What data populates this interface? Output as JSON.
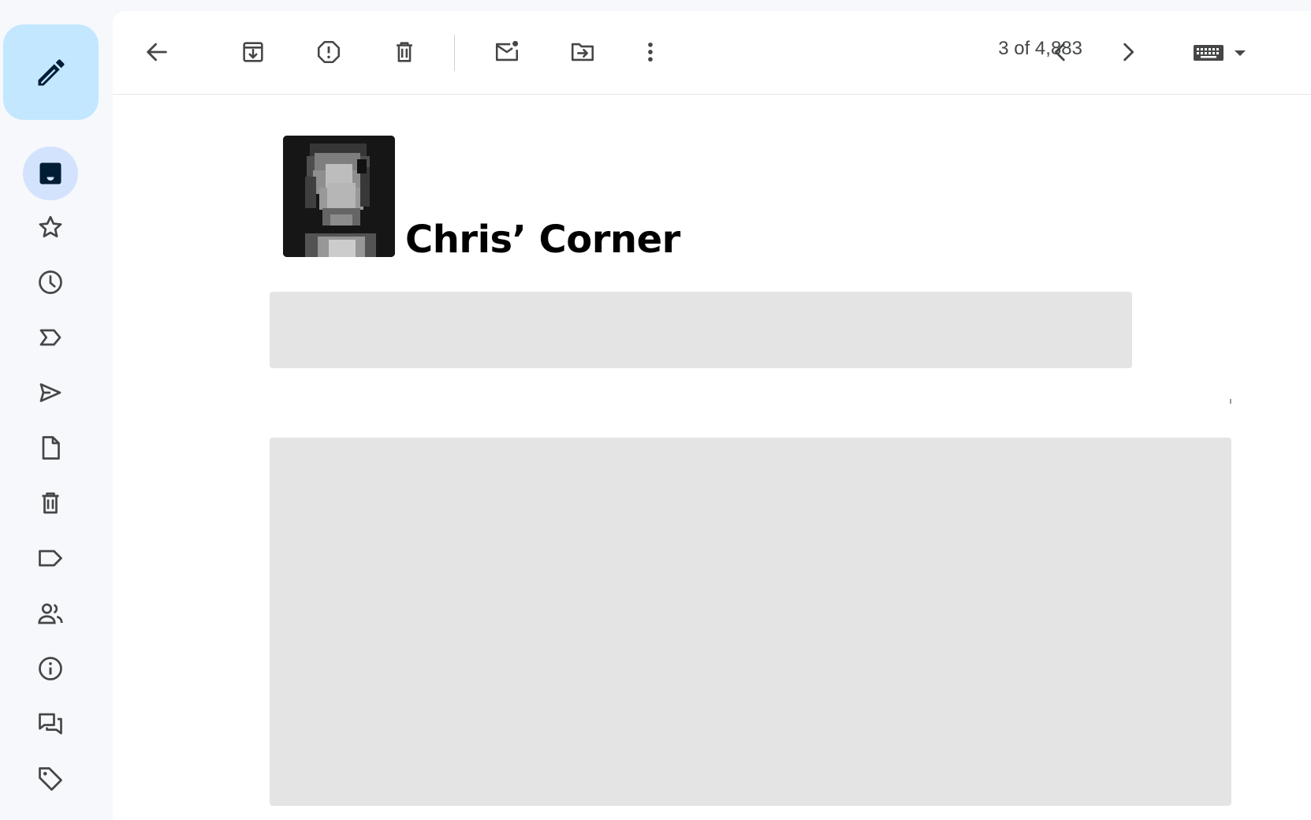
{
  "toolbar": {
    "pager_text": "3 of 4,883"
  },
  "email": {
    "sender_name": "Chris’ Corner"
  },
  "colors": {
    "rail_background": "#f6f8fc",
    "compose_background": "#c2e7ff",
    "active_item_background": "#d3e3fd",
    "placeholder": "#e4e4e4"
  },
  "rail": {
    "items": [
      {
        "name": "inbox",
        "icon": "inbox-icon",
        "active": true
      },
      {
        "name": "starred",
        "icon": "star-icon"
      },
      {
        "name": "snoozed",
        "icon": "clock-icon"
      },
      {
        "name": "important",
        "icon": "important-icon"
      },
      {
        "name": "sent",
        "icon": "send-icon"
      },
      {
        "name": "drafts",
        "icon": "file-icon"
      },
      {
        "name": "trash",
        "icon": "trash-icon"
      },
      {
        "name": "labels",
        "icon": "label-icon"
      },
      {
        "name": "social",
        "icon": "people-icon"
      },
      {
        "name": "updates",
        "icon": "info-icon"
      },
      {
        "name": "forums",
        "icon": "forum-icon"
      },
      {
        "name": "promotions",
        "icon": "tag-icon"
      }
    ]
  }
}
